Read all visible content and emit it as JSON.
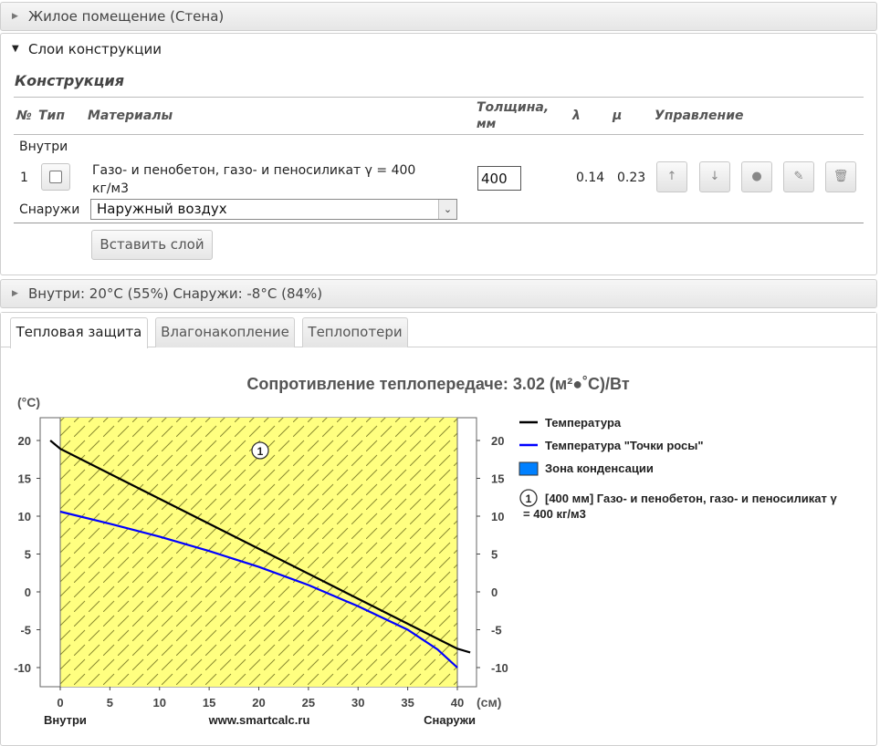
{
  "sections": {
    "room": "Жилое помещение (Стена)",
    "layers": "Слои конструкции",
    "climate": "Внутри: 20°С (55%) Снаружи: -8°С (84%)"
  },
  "construction": {
    "title": "Конструкция",
    "headers": {
      "num": "№",
      "type": "Тип",
      "materials": "Материалы",
      "thickness_1": "Толщина,",
      "thickness_2": "мм",
      "lambda": "λ",
      "mu": "μ",
      "control": "Управление"
    },
    "inside_label": "Внутри",
    "outside_label": "Снаружи",
    "layer": {
      "num": "1",
      "material_1": "Газо- и пенобетон, газо- и пеносиликат γ = 400",
      "material_2": "кг/м3",
      "thickness": "400",
      "lambda": "0.14",
      "mu": "0.23"
    },
    "outside_select": "Наружный воздух",
    "insert_button": "Вставить слой"
  },
  "tabs": [
    "Тепловая защита",
    "Влагонакопление",
    "Теплопотери"
  ],
  "chart_data": {
    "type": "line",
    "title": "Сопротивление теплопередаче: 3.02 (м²●˚С)/Вт",
    "ylabel": "(°С)",
    "xlabel": "(см)",
    "x_left_label": "Внутри",
    "x_center_label": "www.smartcalc.ru",
    "x_right_label": "Снаружи",
    "xlim": [
      -2,
      42
    ],
    "ylim": [
      -12.5,
      22
    ],
    "x_ticks": [
      0,
      5,
      10,
      15,
      20,
      25,
      30,
      35,
      40
    ],
    "y_ticks": [
      20,
      15,
      10,
      5,
      0,
      -5,
      -10
    ],
    "layer_marker": "1",
    "series": [
      {
        "name": "Температура",
        "color": "#000000",
        "x": [
          -1,
          0,
          40,
          41.3
        ],
        "y": [
          20,
          18.9,
          -7.5,
          -8
        ]
      },
      {
        "name": "Температура \"Точки росы\"",
        "color": "#0000ff",
        "x": [
          0,
          5,
          10,
          15,
          20,
          25,
          30,
          35,
          38,
          40
        ],
        "y": [
          10.6,
          9.0,
          7.3,
          5.4,
          3.3,
          0.9,
          -1.9,
          -5.0,
          -7.6,
          -10
        ]
      }
    ],
    "legend": {
      "temperature": "Температура",
      "dew": "Температура \"Точки росы\"",
      "condensation": "Зона конденсации",
      "layer_1": "[400 мм] Газо- и пенобетон, газо- и пеносиликат γ",
      "layer_2": "= 400 кг/м3"
    },
    "colors": {
      "layer_fill": "#ffff80",
      "condensation": "#0080ff"
    }
  }
}
